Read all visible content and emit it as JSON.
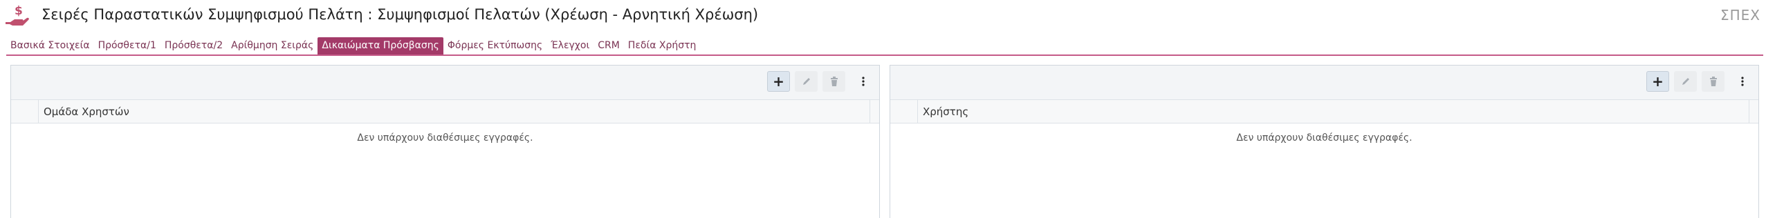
{
  "window": {
    "title": "Σειρές Παραστατικών Συμψηφισμού Πελάτη : Συμψηφισμοί Πελατών (Χρέωση - Αρνητική Χρέωση)",
    "badge": "ΣΠΕΧ",
    "icon": "hand-money-icon"
  },
  "colors": {
    "accent": "#a33a68",
    "accent_line": "#c55a88",
    "icon_pink": "#c0506e"
  },
  "tabs": [
    {
      "label": "Βασικά Στοιχεία",
      "active": false
    },
    {
      "label": "Πρόσθετα/1",
      "active": false
    },
    {
      "label": "Πρόσθετα/2",
      "active": false
    },
    {
      "label": "Αρίθμηση Σειράς",
      "active": false
    },
    {
      "label": "Δικαιώματα Πρόσβασης",
      "active": true
    },
    {
      "label": "Φόρμες Εκτύπωσης",
      "active": false
    },
    {
      "label": "Έλεγχοι",
      "active": false
    },
    {
      "label": "CRM",
      "active": false
    },
    {
      "label": "Πεδία Χρήστη",
      "active": false
    }
  ],
  "left_grid": {
    "column": "Ομάδα Χρηστών",
    "empty_text": "Δεν υπάρχουν διαθέσιμες εγγραφές.",
    "toolbar": {
      "add": "+",
      "edit": "pencil-icon",
      "delete": "trash-icon",
      "more": "more-vertical-icon"
    }
  },
  "right_grid": {
    "column": "Χρήστης",
    "empty_text": "Δεν υπάρχουν διαθέσιμες εγγραφές.",
    "toolbar": {
      "add": "+",
      "edit": "pencil-icon",
      "delete": "trash-icon",
      "more": "more-vertical-icon"
    }
  }
}
